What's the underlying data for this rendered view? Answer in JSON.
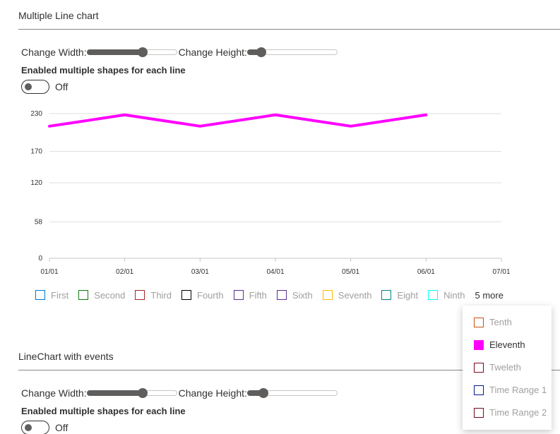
{
  "section1": {
    "title": "Multiple Line chart",
    "change_width_label": "Change Width:",
    "change_height_label": "Change Height:",
    "width_slider_value": 0.62,
    "height_slider_value": 0.16,
    "shapes_label": "Enabled multiple shapes for each line",
    "toggle_text": "Off"
  },
  "section2": {
    "title": "LineChart with events",
    "change_width_label": "Change Width:",
    "change_height_label": "Change Height:",
    "width_slider_value": 0.62,
    "height_slider_value": 0.18,
    "shapes_label": "Enabled multiple shapes for each line",
    "toggle_text": "Off"
  },
  "chart_data": {
    "type": "line",
    "x": [
      "01/01",
      "02/01",
      "03/01",
      "04/01",
      "05/01",
      "06/01"
    ],
    "x_ticks": [
      "01/01",
      "02/01",
      "03/01",
      "04/01",
      "05/01",
      "06/01",
      "07/01"
    ],
    "y_ticks": [
      0,
      58,
      120,
      170,
      230
    ],
    "ylim": [
      0,
      230
    ],
    "grid": true,
    "series": [
      {
        "name": "Eleventh",
        "values": [
          210,
          228,
          210,
          228,
          210,
          228
        ],
        "color": "#ff00ff"
      }
    ]
  },
  "legend": {
    "items": [
      {
        "label": "First",
        "color": "#0078d4"
      },
      {
        "label": "Second",
        "color": "#107c10"
      },
      {
        "label": "Third",
        "color": "#a4262c"
      },
      {
        "label": "Fourth",
        "color": "#000000"
      },
      {
        "label": "Fifth",
        "color": "#5c2e91"
      },
      {
        "label": "Sixth",
        "color": "#5c2e91"
      },
      {
        "label": "Seventh",
        "color": "#ffb900"
      },
      {
        "label": "Eight",
        "color": "#038387"
      },
      {
        "label": "Ninth",
        "color": "#00ffff"
      }
    ],
    "more_label": "5 more",
    "overflow_items": [
      {
        "label": "Tenth",
        "color": "#ca5010",
        "active": false
      },
      {
        "label": "Eleventh",
        "color": "#ff00ff",
        "active": true
      },
      {
        "label": "Tweleth",
        "color": "#750b1c",
        "active": false
      },
      {
        "label": "Time Range 1",
        "color": "#00188f",
        "active": false
      },
      {
        "label": "Time Range 2",
        "color": "#750b1c",
        "active": false
      }
    ]
  }
}
